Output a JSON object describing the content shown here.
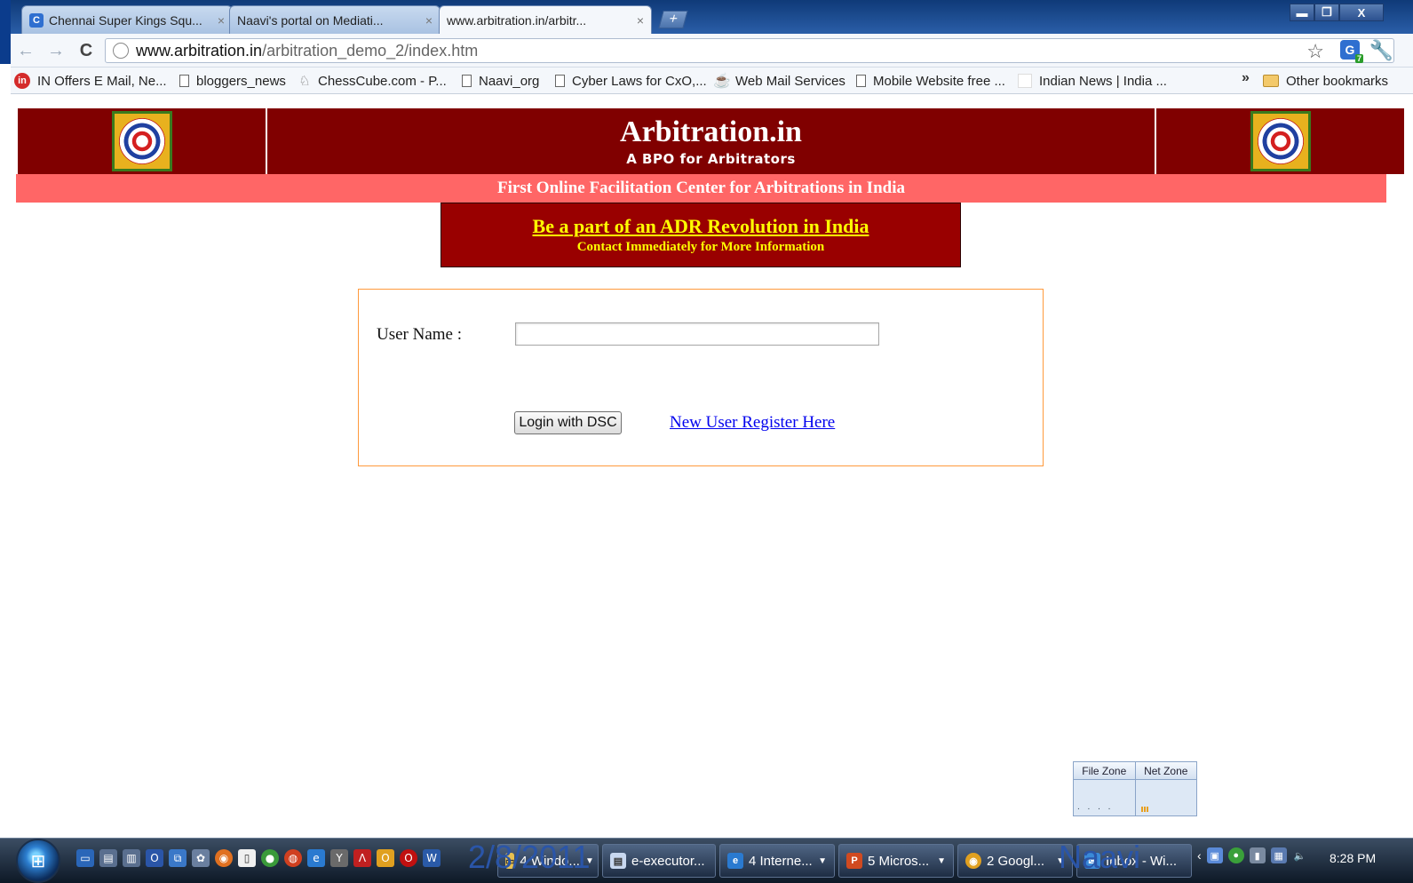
{
  "browser": {
    "tabs": [
      {
        "label": "Chennai Super Kings Squ...",
        "icon": "cricket-site-icon",
        "close": "×"
      },
      {
        "label": "Naavi's portal on Mediati...",
        "icon": "page-icon",
        "close": "×"
      },
      {
        "label": "www.arbitration.in/arbitr...",
        "icon": "page-icon",
        "close": "×",
        "active": true
      }
    ],
    "new_tab": "+",
    "window_controls": {
      "minimize": "▬",
      "restore": "❐",
      "close": "X"
    },
    "nav": {
      "back": "←",
      "forward": "→",
      "reload": "C"
    },
    "url": {
      "host": "www.arbitration.in",
      "path": "/arbitration_demo_2/index.htm"
    },
    "extension_badge": "7",
    "bookmarks": [
      {
        "label": "IN Offers E Mail, Ne...",
        "icon": "in-icon"
      },
      {
        "label": "bloggers_news",
        "icon": "doc-icon"
      },
      {
        "label": "ChessCube.com - P...",
        "icon": "chess-icon"
      },
      {
        "label": "Naavi_org",
        "icon": "doc-icon"
      },
      {
        "label": "Cyber Laws for CxO,...",
        "icon": "doc-icon"
      },
      {
        "label": "Web Mail Services",
        "icon": "java-icon"
      },
      {
        "label": "Mobile Website free ...",
        "icon": "doc-icon"
      },
      {
        "label": "Indian News | India ...",
        "icon": "blank-icon"
      }
    ],
    "bookmarks_more": "»",
    "other_bookmarks": "Other bookmarks"
  },
  "page": {
    "site_title": "Arbitration.in",
    "tagline": "A BPO for Arbitrators",
    "subbanner": "First Online Facilitation Center for Arbitrations in India",
    "adr": {
      "link": "Be a part of an ADR Revolution in India",
      "sub": "Contact Immediately for More Information"
    },
    "login": {
      "username_label": "User Name :",
      "username_value": "",
      "button": "Login with DSC",
      "register_link": "New User Register Here"
    },
    "zone_widget": {
      "file_zone": "File Zone",
      "net_zone": "Net Zone"
    }
  },
  "taskbar": {
    "tasks": [
      {
        "label": "4 Windo...",
        "icon": "folder-icon"
      },
      {
        "label": "e-executor...",
        "icon": "notepad-icon"
      },
      {
        "label": "4 Interne...",
        "icon": "ie-icon"
      },
      {
        "label": "5 Micros...",
        "icon": "powerpoint-icon"
      },
      {
        "label": "2 Googl...",
        "icon": "chrome-icon"
      },
      {
        "label": "Inbox - Wi...",
        "icon": "mail-icon"
      }
    ],
    "overlay_date": "2/8/2011",
    "overlay_name": "Naavi",
    "clock": "8:28 PM"
  },
  "colors": {
    "header_maroon": "#800000",
    "subbanner_pink": "#ff6666",
    "adr_red": "#990000",
    "adr_text_yellow": "#ffff00",
    "login_border_orange": "#ff9a3c",
    "link_blue": "#0000ee"
  }
}
